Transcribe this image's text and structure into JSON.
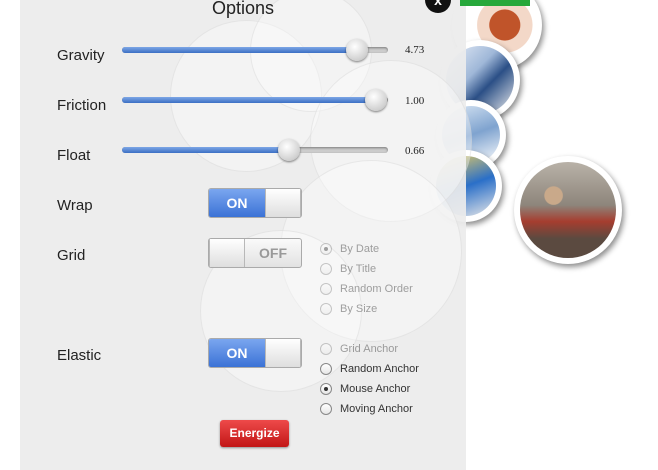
{
  "panel": {
    "title": "Options",
    "close_label": "x"
  },
  "sliders": [
    {
      "label": "Gravity",
      "value_text": "4.73",
      "fraction": 0.92
    },
    {
      "label": "Friction",
      "value_text": "1.00",
      "fraction": 1.0
    },
    {
      "label": "Float",
      "value_text": "0.66",
      "fraction": 0.64
    }
  ],
  "toggles": {
    "wrap": {
      "label": "Wrap",
      "state": "ON"
    },
    "grid": {
      "label": "Grid",
      "state": "OFF"
    },
    "elastic": {
      "label": "Elastic",
      "state": "ON"
    }
  },
  "grid_options": [
    {
      "label": "By Date",
      "selected": true,
      "enabled": false
    },
    {
      "label": "By Title",
      "selected": false,
      "enabled": false
    },
    {
      "label": "Random Order",
      "selected": false,
      "enabled": false
    },
    {
      "label": "By Size",
      "selected": false,
      "enabled": false
    }
  ],
  "anchor_options": [
    {
      "label": "Grid Anchor",
      "selected": false,
      "enabled": false
    },
    {
      "label": "Random Anchor",
      "selected": false,
      "enabled": true
    },
    {
      "label": "Mouse Anchor",
      "selected": true,
      "enabled": true
    },
    {
      "label": "Moving Anchor",
      "selected": false,
      "enabled": true
    }
  ],
  "energize_label": "Energize",
  "colors": {
    "accent_blue": "#3b72d6",
    "energize_red": "#c21616",
    "panel_bg": "#ececec",
    "green_tab": "#27a83b"
  }
}
